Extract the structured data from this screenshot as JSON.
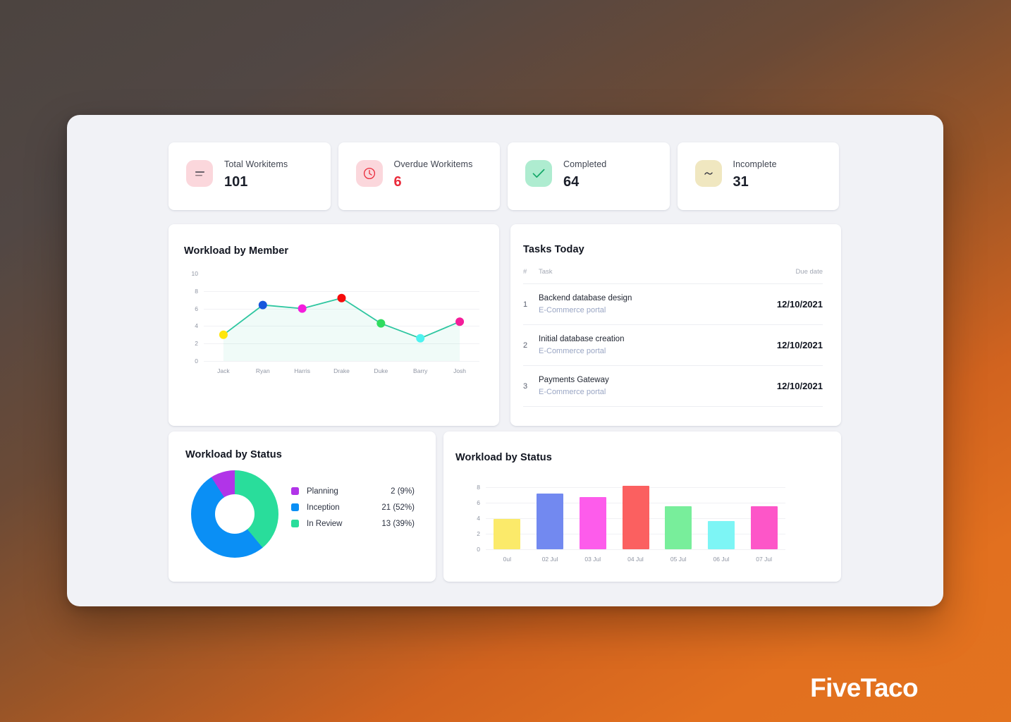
{
  "brand": {
    "name": "FiveTaco"
  },
  "stats": [
    {
      "label": "Total Workitems",
      "value": "101",
      "icon": "list-icon",
      "icon_bg": "#fbd7dc",
      "icon_color": "#3b3b44",
      "value_color": "#1b1f2a"
    },
    {
      "label": "Overdue Workitems",
      "value": "6",
      "icon": "clock-icon",
      "icon_bg": "#fbd7dc",
      "icon_color": "#ea2b3b",
      "value_color": "#ea2b3b"
    },
    {
      "label": "Completed",
      "value": "64",
      "icon": "check-icon",
      "icon_bg": "#aeecd0",
      "icon_color": "#13a868",
      "value_color": "#1b1f2a"
    },
    {
      "label": "Incomplete",
      "value": "31",
      "icon": "tilde-icon",
      "icon_bg": "#f0e7c0",
      "icon_color": "#3b3b44",
      "value_color": "#1b1f2a"
    }
  ],
  "workload_member": {
    "title": "Workload by Member"
  },
  "tasks_today": {
    "title": "Tasks Today",
    "columns": {
      "num": "#",
      "task": "Task",
      "due": "Due date"
    },
    "rows": [
      {
        "index": "1",
        "name": "Backend database design",
        "project": "E-Commerce portal",
        "due": "12/10/2021"
      },
      {
        "index": "2",
        "name": "Initial database creation",
        "project": "E-Commerce portal",
        "due": "12/10/2021"
      },
      {
        "index": "3",
        "name": "Payments Gateway",
        "project": "E-Commerce portal",
        "due": "12/10/2021"
      }
    ]
  },
  "workload_status_donut": {
    "title": "Workload by Status",
    "legend": [
      {
        "name": "Planning",
        "value": "2 (9%)"
      },
      {
        "name": "Inception",
        "value": "21 (52%)"
      },
      {
        "name": "In Review",
        "value": "13 (39%)"
      }
    ]
  },
  "workload_status_bars": {
    "title": "Workload by Status"
  },
  "chart_data": [
    {
      "type": "line",
      "title": "Workload by Member",
      "xlabel": "",
      "ylabel": "",
      "categories": [
        "Jack",
        "Ryan",
        "Harris",
        "Drake",
        "Duke",
        "Barry",
        "Josh"
      ],
      "values": [
        3,
        6.4,
        6,
        7.2,
        4.3,
        2.6,
        4.5
      ],
      "point_colors": [
        "#ffe60a",
        "#1656dc",
        "#f41ddc",
        "#f60b0b",
        "#2fdc5f",
        "#4df3f0",
        "#f41d9a"
      ],
      "line_color": "#2ec6a0",
      "fill": "rgba(46,198,160,0.07)",
      "yticks": [
        0,
        2,
        4,
        6,
        8,
        10
      ],
      "ylim": [
        0,
        10
      ],
      "grid": true,
      "legend": "none"
    },
    {
      "type": "pie",
      "subtype": "donut",
      "title": "Workload by Status",
      "labels": [
        "Planning",
        "Inception",
        "In Review"
      ],
      "values": [
        2,
        21,
        13
      ],
      "percents": [
        9,
        52,
        39
      ],
      "display_values": [
        "2 (9%)",
        "21 (52%)",
        "13 (39%)"
      ],
      "colors": [
        "#b134e8",
        "#0a8ff5",
        "#29dd9b"
      ],
      "legend": "right"
    },
    {
      "type": "bar",
      "title": "Workload by Status",
      "xlabel": "",
      "ylabel": "",
      "categories": [
        "0ul",
        "02 Jul",
        "03 Jul",
        "04 Jul",
        "05 Jul",
        "06 Jul",
        "07 Jul"
      ],
      "values": [
        3.9,
        7.2,
        6.7,
        8.2,
        5.5,
        3.65,
        5.5
      ],
      "bar_colors": [
        "#fbea6a",
        "#7289f0",
        "#fd5ceb",
        "#fb6060",
        "#78ee9b",
        "#7df5f5",
        "#fd56c8"
      ],
      "yticks": [
        0,
        2,
        4,
        6,
        8
      ],
      "ylim": [
        0,
        8.8
      ],
      "grid": true,
      "legend": "none"
    }
  ]
}
